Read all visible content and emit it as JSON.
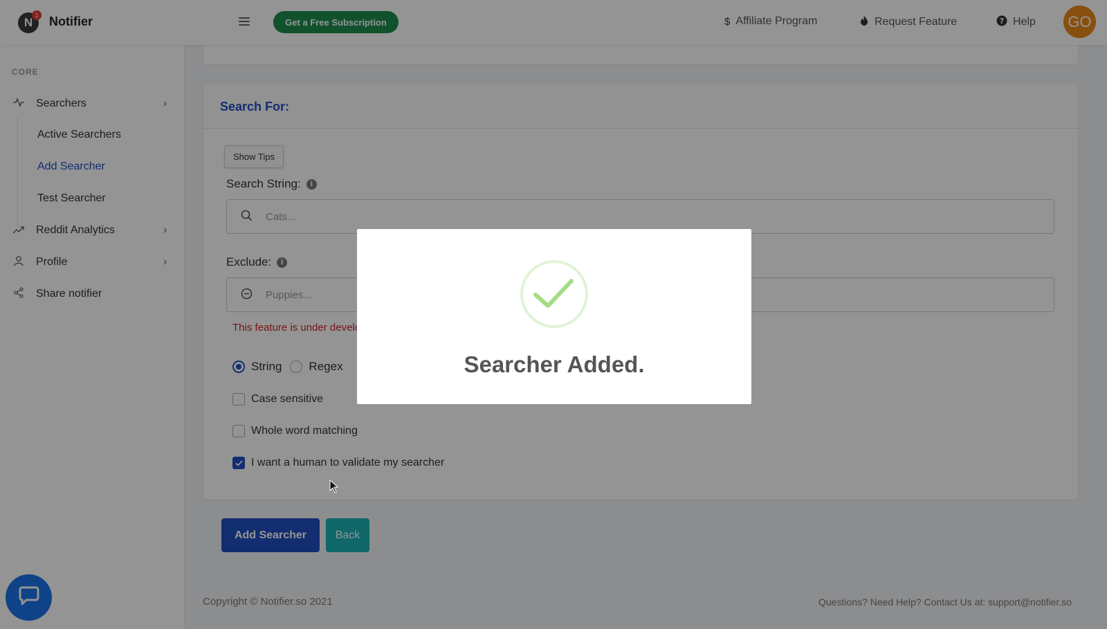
{
  "header": {
    "brand": "Notifier",
    "badge_count": "1",
    "logo_letter": "N",
    "subscription_button": "Get a Free Subscription",
    "nav": [
      {
        "icon": "dollar-icon",
        "label": "Affiliate Program"
      },
      {
        "icon": "fire-icon",
        "label": "Request Feature"
      },
      {
        "icon": "question-circle-icon",
        "label": "Help"
      }
    ],
    "avatar_initials": "GO",
    "colors": {
      "subscription": "#1e8e4e",
      "avatar": "#e8891d"
    }
  },
  "sidebar": {
    "heading": "CORE",
    "items": [
      {
        "icon": "activity-icon",
        "label": "Searchers",
        "expandable": true
      },
      {
        "icon": "trending-up-icon",
        "label": "Reddit Analytics",
        "expandable": true
      },
      {
        "icon": "user-icon",
        "label": "Profile",
        "expandable": true
      },
      {
        "icon": "share-icon",
        "label": "Share notifier",
        "expandable": false
      }
    ],
    "subitems": [
      {
        "label": "Active Searchers",
        "active": false
      },
      {
        "label": "Add Searcher",
        "active": true
      },
      {
        "label": "Test Searcher",
        "active": false
      }
    ]
  },
  "form": {
    "title": "Search For:",
    "show_tips": "Show Tips",
    "search_string_label": "Search String:",
    "search_string_placeholder": "Cats...",
    "exclude_label": "Exclude:",
    "exclude_placeholder": "Puppies...",
    "warning": "This feature is under development",
    "match_mode": {
      "options": [
        "String",
        "Regex"
      ],
      "selected": "String"
    },
    "options": [
      {
        "label": "Case sensitive",
        "checked": false
      },
      {
        "label": "Whole word matching",
        "checked": false
      },
      {
        "label": "I want a human to validate my searcher",
        "checked": true
      }
    ],
    "add_button": "Add Searcher",
    "back_button": "Back"
  },
  "footer": {
    "copyright": "Copyright © Notifier.so 2021",
    "help": "Questions? Need Help? Contact Us at: support@notifier.so"
  },
  "modal": {
    "icon": "success-check-icon",
    "title": "Searcher Added."
  }
}
